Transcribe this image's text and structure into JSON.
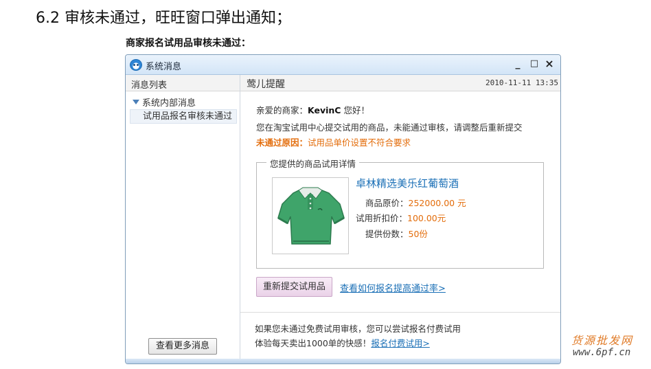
{
  "page": {
    "heading": "6.2 审核未通过，旺旺窗口弹出通知；",
    "subheading": "商家报名试用品审核未通过：",
    "watermark": {
      "line1": "货源批发网",
      "line2": "www.6pf.cn"
    }
  },
  "window": {
    "title": "系统消息",
    "controls": {
      "minimize": "_",
      "maximize": "□",
      "close": "×"
    },
    "colors": {
      "accent": "#1a6fb6",
      "warning": "#e36c0a"
    }
  },
  "sidebar": {
    "header": "消息列表",
    "group_label": "系统内部消息",
    "items": [
      {
        "label": "试用品报名审核未通过"
      }
    ],
    "more_button": "查看更多消息"
  },
  "message": {
    "sender": "莺儿提醒",
    "timestamp": "2010-11-11 13:35",
    "greeting_prefix": "亲爱的商家：",
    "merchant_name": "KevinC",
    "greeting_suffix": " 您好！",
    "body": "您在淘宝试用中心提交试用的商品，未能通过审核，请调整后重新提交",
    "reason_label": "未通过原因：",
    "reason_text": "试用品单价设置不符合要求",
    "details_legend": "您提供的商品试用详情",
    "product": {
      "image_icon": "green-polo-shirt",
      "name": "卓林精选美乐红葡萄酒",
      "original_price_label": "商品原价：",
      "original_price": "252000.00 元",
      "trial_price_label": "试用折扣价：",
      "trial_price": "100.00元",
      "quantity_label": "提供份数：",
      "quantity": "50份"
    },
    "resubmit_button": "重新提交试用品",
    "help_link": "查看如何报名提高通过率>",
    "promo_line1": "如果您未通过免费试用审核，您可以尝试报名付费试用",
    "promo_line2_prefix": "体验每天卖出1000单的快感！",
    "paid_trial_link": "报名付费试用>"
  }
}
